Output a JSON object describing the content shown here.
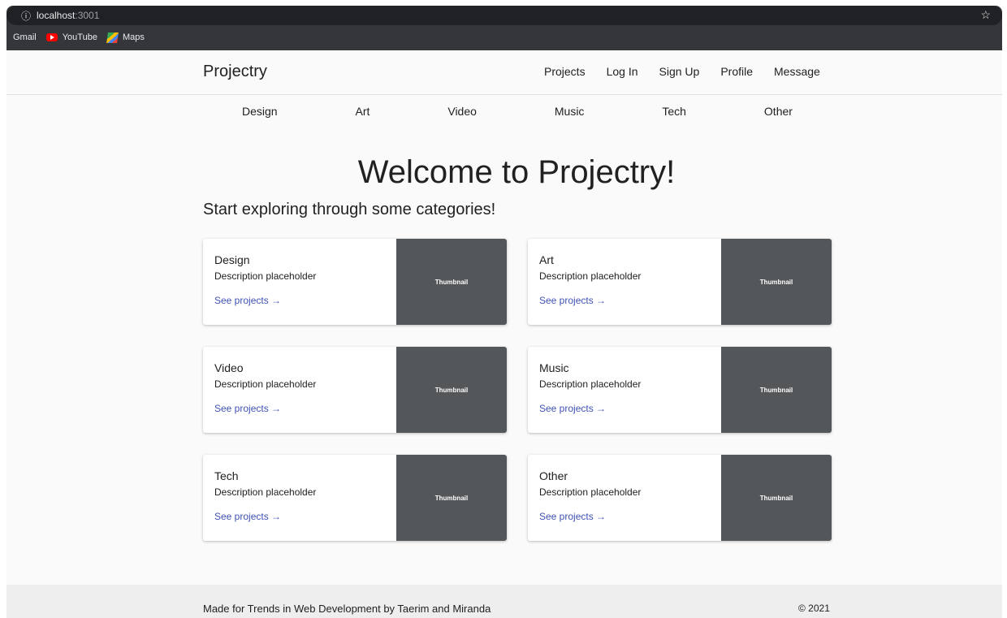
{
  "browser": {
    "info_icon": "ⓘ",
    "host": "localhost",
    "port": ":3001",
    "star_icon": "☆",
    "bookmarks": [
      {
        "label": "Gmail",
        "icon": "none"
      },
      {
        "label": "YouTube",
        "icon": "youtube-icon"
      },
      {
        "label": "Maps",
        "icon": "maps-icon"
      }
    ]
  },
  "header": {
    "brand": "Projectry",
    "nav": [
      "Projects",
      "Log In",
      "Sign Up",
      "Profile",
      "Message"
    ]
  },
  "categories_bar": [
    "Design",
    "Art",
    "Video",
    "Music",
    "Tech",
    "Other"
  ],
  "main": {
    "welcome": "Welcome to Projectry!",
    "subtitle": "Start exploring through some categories!",
    "cards": [
      {
        "title": "Design",
        "description": "Description placeholder",
        "link": "See projects →",
        "thumbnail": "Thumbnail"
      },
      {
        "title": "Art",
        "description": "Description placeholder",
        "link": "See projects →",
        "thumbnail": "Thumbnail"
      },
      {
        "title": "Video",
        "description": "Description placeholder",
        "link": "See projects →",
        "thumbnail": "Thumbnail"
      },
      {
        "title": "Music",
        "description": "Description placeholder",
        "link": "See projects →",
        "thumbnail": "Thumbnail"
      },
      {
        "title": "Tech",
        "description": "Description placeholder",
        "link": "See projects →",
        "thumbnail": "Thumbnail"
      },
      {
        "title": "Other",
        "description": "Description placeholder",
        "link": "See projects →",
        "thumbnail": "Thumbnail"
      }
    ]
  },
  "footer": {
    "text": "Made for Trends in Web Development by Taerim and Miranda",
    "copyright": "© 2021"
  },
  "colors": {
    "link": "#3f51b5",
    "thumbnail_bg": "#54575a",
    "page_bg": "#fafafa"
  }
}
